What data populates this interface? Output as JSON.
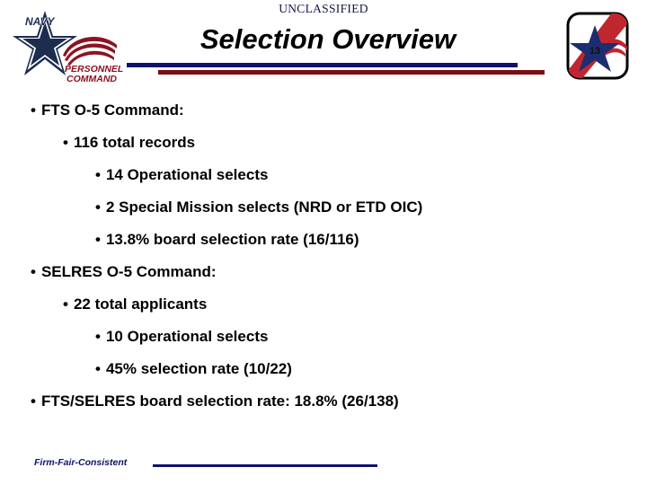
{
  "slide": {
    "classification": "UNCLASSIFIED",
    "title": "Selection Overview",
    "footer_note": "Firm-Fair-Consistent"
  },
  "colors": {
    "navy": "#10106e",
    "dark_red": "#7a0d12",
    "text": "#000000",
    "background": "#ffffff"
  },
  "logos": {
    "left": {
      "name": "navy-personnel-command-logo",
      "line1": "NAVY",
      "line2": "PERSONNEL",
      "line3": "COMMAND"
    },
    "right": {
      "name": "board-badge-logo",
      "number": "13"
    }
  },
  "bullets": [
    {
      "level": 1,
      "marker": "•",
      "text": "FTS O-5 Command:"
    },
    {
      "level": 2,
      "marker": "•",
      "text": "116 total records"
    },
    {
      "level": 3,
      "marker": "•",
      "text": "14 Operational selects"
    },
    {
      "level": 3,
      "marker": "•",
      "text": "2 Special Mission selects (NRD or ETD OIC)"
    },
    {
      "level": 3,
      "marker": "•",
      "text": "13.8% board selection rate (16/116)"
    },
    {
      "level": 1,
      "marker": "•",
      "text": "SELRES O-5 Command:"
    },
    {
      "level": 2,
      "marker": "•",
      "text": "22 total applicants"
    },
    {
      "level": 3,
      "marker": "•",
      "text": "10 Operational selects"
    },
    {
      "level": 3,
      "marker": "•",
      "text": "45% selection rate (10/22)"
    },
    {
      "level": 1,
      "marker": "•",
      "text": "FTS/SELRES board selection rate: 18.8% (26/138)"
    }
  ]
}
